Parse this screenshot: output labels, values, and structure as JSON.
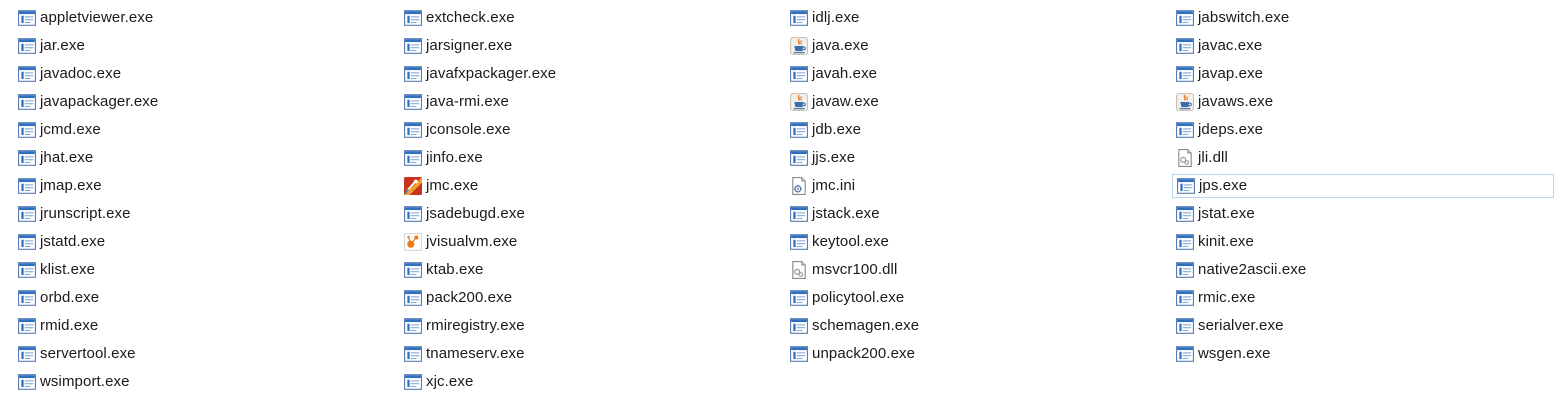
{
  "file_list": {
    "hovered_item": "jps.exe",
    "columns": [
      {
        "items": [
          {
            "name": "appletviewer.exe",
            "icon": "exe-app-icon"
          },
          {
            "name": "jar.exe",
            "icon": "exe-app-icon"
          },
          {
            "name": "javadoc.exe",
            "icon": "exe-app-icon"
          },
          {
            "name": "javapackager.exe",
            "icon": "exe-app-icon"
          },
          {
            "name": "jcmd.exe",
            "icon": "exe-app-icon"
          },
          {
            "name": "jhat.exe",
            "icon": "exe-app-icon"
          },
          {
            "name": "jmap.exe",
            "icon": "exe-app-icon"
          },
          {
            "name": "jrunscript.exe",
            "icon": "exe-app-icon"
          },
          {
            "name": "jstatd.exe",
            "icon": "exe-app-icon"
          },
          {
            "name": "klist.exe",
            "icon": "exe-app-icon"
          },
          {
            "name": "orbd.exe",
            "icon": "exe-app-icon"
          },
          {
            "name": "rmid.exe",
            "icon": "exe-app-icon"
          },
          {
            "name": "servertool.exe",
            "icon": "exe-app-icon"
          },
          {
            "name": "wsimport.exe",
            "icon": "exe-app-icon"
          }
        ]
      },
      {
        "items": [
          {
            "name": "extcheck.exe",
            "icon": "exe-app-icon"
          },
          {
            "name": "jarsigner.exe",
            "icon": "exe-app-icon"
          },
          {
            "name": "javafxpackager.exe",
            "icon": "exe-app-icon"
          },
          {
            "name": "java-rmi.exe",
            "icon": "exe-app-icon"
          },
          {
            "name": "jconsole.exe",
            "icon": "exe-app-icon"
          },
          {
            "name": "jinfo.exe",
            "icon": "exe-app-icon"
          },
          {
            "name": "jmc.exe",
            "icon": "mission-control-icon"
          },
          {
            "name": "jsadebugd.exe",
            "icon": "exe-app-icon"
          },
          {
            "name": "jvisualvm.exe",
            "icon": "visualvm-icon"
          },
          {
            "name": "ktab.exe",
            "icon": "exe-app-icon"
          },
          {
            "name": "pack200.exe",
            "icon": "exe-app-icon"
          },
          {
            "name": "rmiregistry.exe",
            "icon": "exe-app-icon"
          },
          {
            "name": "tnameserv.exe",
            "icon": "exe-app-icon"
          },
          {
            "name": "xjc.exe",
            "icon": "exe-app-icon"
          }
        ]
      },
      {
        "items": [
          {
            "name": "idlj.exe",
            "icon": "exe-app-icon"
          },
          {
            "name": "java.exe",
            "icon": "java-cup-icon"
          },
          {
            "name": "javah.exe",
            "icon": "exe-app-icon"
          },
          {
            "name": "javaw.exe",
            "icon": "java-cup-icon"
          },
          {
            "name": "jdb.exe",
            "icon": "exe-app-icon"
          },
          {
            "name": "jjs.exe",
            "icon": "exe-app-icon"
          },
          {
            "name": "jmc.ini",
            "icon": "ini-settings-icon"
          },
          {
            "name": "jstack.exe",
            "icon": "exe-app-icon"
          },
          {
            "name": "keytool.exe",
            "icon": "exe-app-icon"
          },
          {
            "name": "msvcr100.dll",
            "icon": "dll-file-icon"
          },
          {
            "name": "policytool.exe",
            "icon": "exe-app-icon"
          },
          {
            "name": "schemagen.exe",
            "icon": "exe-app-icon"
          },
          {
            "name": "unpack200.exe",
            "icon": "exe-app-icon"
          }
        ]
      },
      {
        "items": [
          {
            "name": "jabswitch.exe",
            "icon": "exe-app-icon"
          },
          {
            "name": "javac.exe",
            "icon": "exe-app-icon"
          },
          {
            "name": "javap.exe",
            "icon": "exe-app-icon"
          },
          {
            "name": "javaws.exe",
            "icon": "java-cup-icon"
          },
          {
            "name": "jdeps.exe",
            "icon": "exe-app-icon"
          },
          {
            "name": "jli.dll",
            "icon": "dll-file-icon"
          },
          {
            "name": "jps.exe",
            "icon": "exe-app-icon"
          },
          {
            "name": "jstat.exe",
            "icon": "exe-app-icon"
          },
          {
            "name": "kinit.exe",
            "icon": "exe-app-icon"
          },
          {
            "name": "native2ascii.exe",
            "icon": "exe-app-icon"
          },
          {
            "name": "rmic.exe",
            "icon": "exe-app-icon"
          },
          {
            "name": "serialver.exe",
            "icon": "exe-app-icon"
          },
          {
            "name": "wsgen.exe",
            "icon": "exe-app-icon"
          }
        ]
      }
    ]
  },
  "colors": {
    "text": "#1a1a1a",
    "hover_border": "#b7d6ee",
    "exe_icon_blue": "#2f6fc2",
    "java_orange": "#e07a1f",
    "java_blue": "#3b6ea8"
  }
}
